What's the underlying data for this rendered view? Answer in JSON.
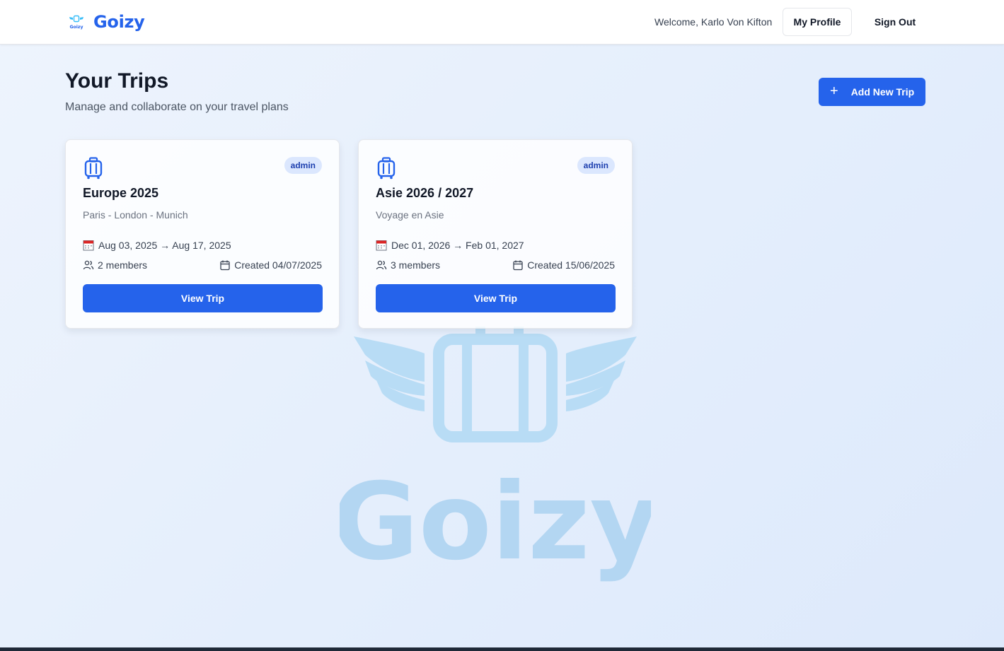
{
  "header": {
    "brand_name": "Goizy",
    "brand_logo_text": "Goizy",
    "welcome_text": "Welcome, Karlo Von Kifton",
    "profile_label": "My Profile",
    "signout_label": "Sign Out"
  },
  "main": {
    "title": "Your Trips",
    "subtitle": "Manage and collaborate on your travel plans",
    "add_trip_label": "Add New Trip",
    "watermark_text": "Goizy"
  },
  "trips": [
    {
      "name": "Europe 2025",
      "description": "Paris - London - Munich",
      "role": "admin",
      "dates": "Aug 03, 2025 → Aug 17, 2025",
      "members": "2 members",
      "created": "Created 04/07/2025",
      "button_label": "View Trip"
    },
    {
      "name": "Asie 2026 / 2027",
      "description": "Voyage en Asie",
      "role": "admin",
      "dates": "Dec 01, 2026 → Feb 01, 2027",
      "members": "3 members",
      "created": "Created 15/06/2025",
      "button_label": "View Trip"
    }
  ],
  "colors": {
    "primary": "#2563eb",
    "badge_bg": "#dbe7fe",
    "badge_text": "#1e40af",
    "watermark": "#b3d6f2"
  },
  "icons": [
    "goizy-logo-icon",
    "plus-icon",
    "luggage-icon",
    "calendar-emoji-icon",
    "users-icon",
    "calendar-icon"
  ]
}
